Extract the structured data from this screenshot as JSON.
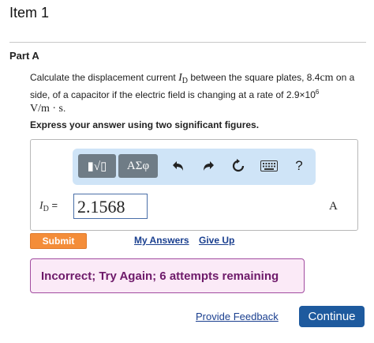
{
  "header": {
    "title": "Item 1"
  },
  "part": {
    "title": "Part A"
  },
  "question": {
    "text_1": "Calculate the displacement current ",
    "current_symbol": "I",
    "current_subscript": "D",
    "text_2": " between the square plates, 8.4",
    "unit_cm": "cm",
    "text_3": " on a side, of a capacitor if the electric field is changing at a rate of 2.9×10",
    "exponent": "6",
    "rate_unit": "V/m · s",
    "text_end": "."
  },
  "instruction": "Express your answer using two significant figures.",
  "toolbar": {
    "template_label": "▮√▯",
    "greek_label": "ΑΣφ",
    "help_label": "?",
    "icons": [
      "templates-icon",
      "greek-symbols-icon",
      "undo-icon",
      "redo-icon",
      "reset-icon",
      "keyboard-icon",
      "help-icon"
    ]
  },
  "answer": {
    "label_symbol": "I",
    "label_subscript": "D",
    "label_equals": " =",
    "value": "2.1568",
    "unit": "A"
  },
  "actions": {
    "submit_label": "Submit",
    "my_answers_label": "My Answers",
    "give_up_label": "Give Up"
  },
  "feedback": {
    "message": "Incorrect; Try Again; 6 attempts remaining",
    "text_color": "#6e1a6a",
    "background_color": "#fbeaf7",
    "border_color": "#a24ca0"
  },
  "footer": {
    "provide_feedback_label": "Provide Feedback",
    "continue_label": "Continue"
  },
  "colors": {
    "submit_button": "#f48d39",
    "continue_button": "#1e5a9e",
    "toolbar_background": "#cfe4f7",
    "link": "#1a3f8f"
  }
}
